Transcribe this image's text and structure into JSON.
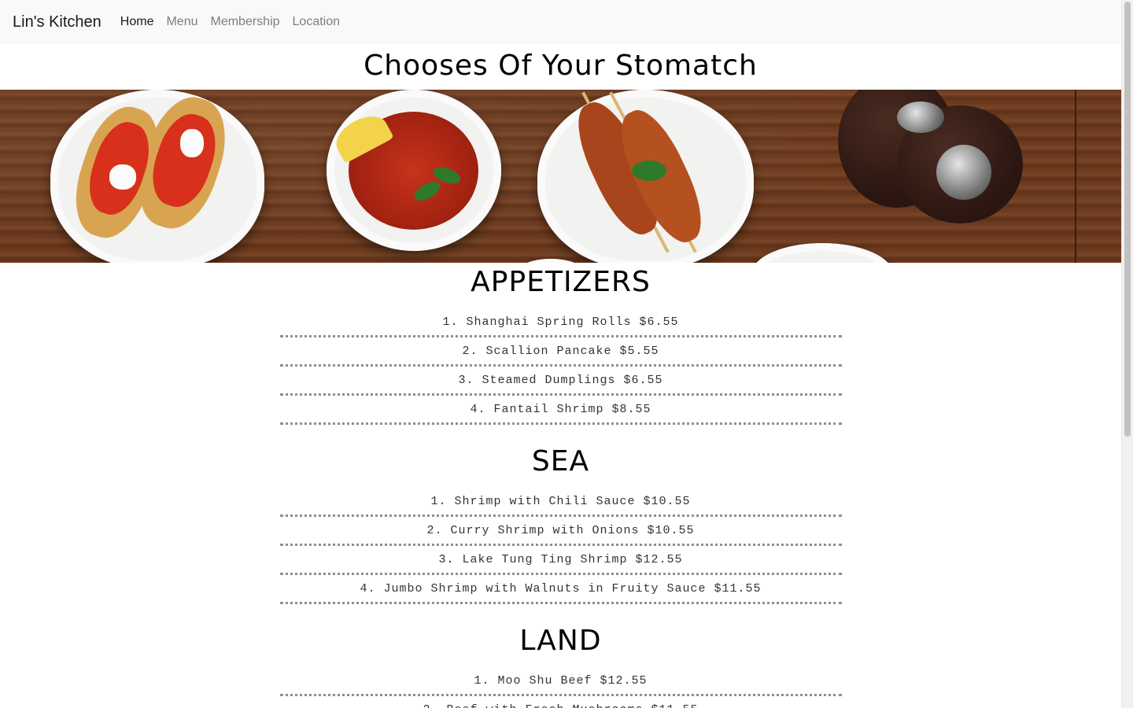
{
  "navbar": {
    "brand": "Lin's Kitchen",
    "links": [
      "Home",
      "Menu",
      "Membership",
      "Location"
    ],
    "active": "Home"
  },
  "page_title": "Chooses Of Your Stomatch",
  "banner": {
    "alt": "food-banner"
  },
  "sections": [
    {
      "title": "APPETIZERS",
      "items": [
        "1. Shanghai Spring Rolls $6.55",
        "2. Scallion Pancake $5.55",
        "3. Steamed Dumplings $6.55",
        "4. Fantail Shrimp $8.55"
      ]
    },
    {
      "title": "SEA",
      "items": [
        "1. Shrimp with Chili Sauce $10.55",
        "2. Curry Shrimp with Onions $10.55",
        "3. Lake Tung Ting Shrimp $12.55",
        "4. Jumbo Shrimp with Walnuts in Fruity Sauce $11.55"
      ]
    },
    {
      "title": "LAND",
      "items": [
        "1. Moo Shu Beef $12.55",
        "2. Beef with Fresh Mushrooms $11.55"
      ]
    }
  ],
  "colors": {
    "navbar_bg": "#f8f9fa",
    "divider": "#9a8a8a",
    "wood": "#6b3a1f"
  }
}
